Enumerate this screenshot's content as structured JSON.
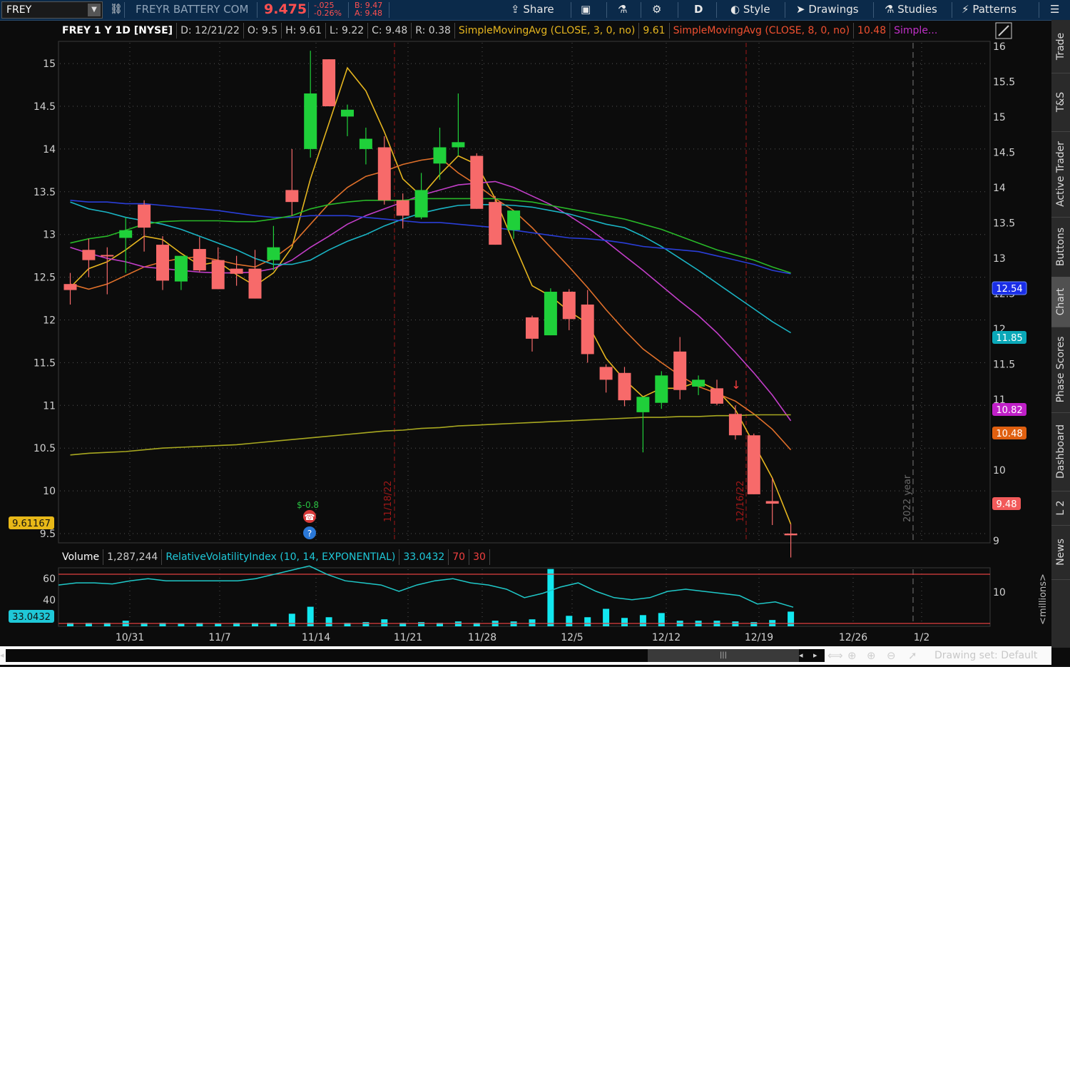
{
  "toolbar": {
    "symbol": "FREY",
    "company": "FREYR BATTERY COM",
    "last_price": "9.475",
    "net_change": "-.025",
    "pct_change": "-0.26%",
    "bid": "B: 9.47",
    "ask": "A: 9.48",
    "share_label": "Share",
    "aggregation": "D",
    "style_label": "Style",
    "drawings_label": "Drawings",
    "studies_label": "Studies",
    "patterns_label": "Patterns"
  },
  "side_tabs": [
    "Trade",
    "T&S",
    "Active Trader",
    "Buttons",
    "Chart",
    "Phase Scores",
    "Dashboard",
    "L 2",
    "News"
  ],
  "info_bar": {
    "title": "FREY 1 Y 1D [NYSE]",
    "date": "D: 12/21/22",
    "open": "O: 9.5",
    "high": "H: 9.61",
    "low": "L: 9.22",
    "close": "C: 9.48",
    "range": "R: 0.38",
    "sma3_label": "SimpleMovingAvg (CLOSE, 3, 0, no)",
    "sma3_value": "9.61",
    "sma8_label": "SimpleMovingAvg (CLOSE, 8, 0, no)",
    "sma8_value": "10.48",
    "sma_more": "Simple..."
  },
  "lower_info": {
    "volume_label": "Volume",
    "volume_value": "1,287,244",
    "rvi_label": "RelativeVolatilityIndex (10, 14, EXPONENTIAL)",
    "rvi_value": "33.0432",
    "level_70": "70",
    "level_30": "30"
  },
  "price_badges": {
    "blue": "12.54",
    "teal": "11.85",
    "magenta": "10.82",
    "orange": "10.48",
    "last": "9.48",
    "left_yellow": "9.61167",
    "left_rvi": "33.0432"
  },
  "chart_annotations": {
    "vline1": "11/18/22",
    "vline2": "12/16/22",
    "year_marker": "2022 year",
    "dividend_label": "$-0.8",
    "millions": "<millions>"
  },
  "bottom_bar": {
    "drawing_set": "Drawing set: Default"
  },
  "colors": {
    "up": "#1fd03a",
    "down": "#f76a6a",
    "sma3": "#e5b51f",
    "sma8": "#e0702a",
    "magenta": "#c23ec8",
    "teal": "#1ab4c4",
    "blue": "#2a3ed8",
    "green": "#28b828",
    "olive": "#a8a820",
    "rvi": "#1fc8c8"
  },
  "chart_data": {
    "type": "candlestick",
    "price_axis_right": [
      9,
      9.5,
      10,
      10.5,
      11,
      11.5,
      12,
      12.5,
      13,
      13.5,
      14,
      14.5,
      15,
      15.5,
      16
    ],
    "price_axis_left": [
      9.5,
      10,
      10.5,
      11,
      11.5,
      12,
      12.5,
      13,
      13.5,
      14,
      14.5,
      15
    ],
    "x_ticks": [
      "10/31",
      "11/7",
      "11/14",
      "11/21",
      "11/28",
      "12/5",
      "12/12",
      "12/19",
      "12/26",
      "1/2"
    ],
    "volume_axis": [
      10
    ],
    "rvi_axis": [
      40,
      60
    ],
    "candles": [
      {
        "o": 12.42,
        "h": 12.55,
        "l": 12.18,
        "c": 12.35
      },
      {
        "o": 12.82,
        "h": 12.95,
        "l": 12.5,
        "c": 12.7
      },
      {
        "o": 12.76,
        "h": 12.85,
        "l": 12.3,
        "c": 12.75
      },
      {
        "o": 12.96,
        "h": 13.2,
        "l": 12.55,
        "c": 13.05
      },
      {
        "o": 13.35,
        "h": 13.4,
        "l": 12.8,
        "c": 13.08
      },
      {
        "o": 12.88,
        "h": 12.98,
        "l": 12.35,
        "c": 12.46
      },
      {
        "o": 12.45,
        "h": 12.75,
        "l": 12.35,
        "c": 12.75
      },
      {
        "o": 12.83,
        "h": 12.97,
        "l": 12.56,
        "c": 12.58
      },
      {
        "o": 12.7,
        "h": 12.85,
        "l": 12.36,
        "c": 12.36
      },
      {
        "o": 12.6,
        "h": 12.75,
        "l": 12.4,
        "c": 12.54
      },
      {
        "o": 12.6,
        "h": 12.82,
        "l": 12.25,
        "c": 12.25
      },
      {
        "o": 12.7,
        "h": 13.1,
        "l": 12.58,
        "c": 12.85
      },
      {
        "o": 13.52,
        "h": 14.0,
        "l": 13.22,
        "c": 13.38
      },
      {
        "o": 14.0,
        "h": 15.15,
        "l": 13.9,
        "c": 14.65
      },
      {
        "o": 15.05,
        "h": 15.05,
        "l": 14.5,
        "c": 14.5
      },
      {
        "o": 14.38,
        "h": 14.52,
        "l": 14.15,
        "c": 14.46
      },
      {
        "o": 14.0,
        "h": 14.25,
        "l": 13.82,
        "c": 14.12
      },
      {
        "o": 14.02,
        "h": 14.15,
        "l": 13.35,
        "c": 13.4
      },
      {
        "o": 13.4,
        "h": 13.48,
        "l": 13.07,
        "c": 13.22
      },
      {
        "o": 13.2,
        "h": 13.72,
        "l": 13.18,
        "c": 13.52
      },
      {
        "o": 13.83,
        "h": 14.25,
        "l": 13.64,
        "c": 14.02
      },
      {
        "o": 14.02,
        "h": 14.65,
        "l": 13.92,
        "c": 14.08
      },
      {
        "o": 13.92,
        "h": 13.95,
        "l": 13.3,
        "c": 13.3
      },
      {
        "o": 13.38,
        "h": 13.45,
        "l": 12.88,
        "c": 12.88
      },
      {
        "o": 13.05,
        "h": 13.28,
        "l": 12.95,
        "c": 13.28
      },
      {
        "o": 12.03,
        "h": 12.05,
        "l": 11.63,
        "c": 11.78
      },
      {
        "o": 11.82,
        "h": 12.37,
        "l": 11.82,
        "c": 12.33
      },
      {
        "o": 12.33,
        "h": 12.36,
        "l": 11.88,
        "c": 12.01
      },
      {
        "o": 12.18,
        "h": 12.35,
        "l": 11.5,
        "c": 11.6
      },
      {
        "o": 11.45,
        "h": 11.48,
        "l": 11.15,
        "c": 11.3
      },
      {
        "o": 11.38,
        "h": 11.45,
        "l": 10.99,
        "c": 11.06
      },
      {
        "o": 10.92,
        "h": 11.05,
        "l": 10.45,
        "c": 11.1
      },
      {
        "o": 11.03,
        "h": 11.4,
        "l": 10.96,
        "c": 11.35
      },
      {
        "o": 11.63,
        "h": 11.8,
        "l": 11.07,
        "c": 11.18
      },
      {
        "o": 11.22,
        "h": 11.35,
        "l": 11.12,
        "c": 11.3
      },
      {
        "o": 11.2,
        "h": 11.3,
        "l": 11.0,
        "c": 11.02
      },
      {
        "o": 10.9,
        "h": 11.0,
        "l": 10.6,
        "c": 10.65
      },
      {
        "o": 10.65,
        "h": 10.67,
        "l": 9.96,
        "c": 9.96
      },
      {
        "o": 9.88,
        "h": 10.15,
        "l": 9.6,
        "c": 9.85
      },
      {
        "o": 9.5,
        "h": 9.61,
        "l": 9.22,
        "c": 9.48
      }
    ],
    "series": [
      {
        "name": "SimpleMovingAvg (CLOSE, 3, 0, no)",
        "color": "#e5b51f",
        "values": [
          12.38,
          12.6,
          12.68,
          12.82,
          12.98,
          12.94,
          12.78,
          12.64,
          12.68,
          12.53,
          12.4,
          12.55,
          12.85,
          13.65,
          14.3,
          14.95,
          14.68,
          14.2,
          13.65,
          13.45,
          13.7,
          13.92,
          13.82,
          13.42,
          12.9,
          12.4,
          12.28,
          12.1,
          11.96,
          11.55,
          11.3,
          11.1,
          11.2,
          11.2,
          11.28,
          11.18,
          10.95,
          10.55,
          10.15,
          9.61
        ]
      },
      {
        "name": "SimpleMovingAvg (CLOSE, 8, 0, no)",
        "color": "#e0702a",
        "values": [
          12.42,
          12.36,
          12.42,
          12.52,
          12.62,
          12.68,
          12.72,
          12.74,
          12.7,
          12.65,
          12.62,
          12.72,
          12.88,
          13.12,
          13.36,
          13.55,
          13.68,
          13.74,
          13.82,
          13.87,
          13.9,
          13.72,
          13.58,
          13.42,
          13.28,
          13.08,
          12.85,
          12.62,
          12.38,
          12.12,
          11.88,
          11.66,
          11.5,
          11.35,
          11.22,
          11.14,
          11.05,
          10.9,
          10.72,
          10.48
        ]
      },
      {
        "name": "magenta MA",
        "color": "#c23ec8",
        "values": [
          12.85,
          12.78,
          12.72,
          12.68,
          12.62,
          12.6,
          12.58,
          12.56,
          12.55,
          12.55,
          12.56,
          12.6,
          12.7,
          12.85,
          12.98,
          13.12,
          13.22,
          13.3,
          13.38,
          13.46,
          13.52,
          13.58,
          13.6,
          13.62,
          13.55,
          13.45,
          13.35,
          13.22,
          13.08,
          12.92,
          12.75,
          12.58,
          12.4,
          12.22,
          12.05,
          11.85,
          11.62,
          11.38,
          11.12,
          10.82
        ]
      },
      {
        "name": "teal MA",
        "color": "#1ab4c4",
        "values": [
          13.38,
          13.3,
          13.26,
          13.2,
          13.16,
          13.12,
          13.06,
          12.98,
          12.9,
          12.82,
          12.72,
          12.65,
          12.65,
          12.7,
          12.82,
          12.92,
          13.0,
          13.1,
          13.18,
          13.25,
          13.3,
          13.34,
          13.35,
          13.35,
          13.34,
          13.32,
          13.28,
          13.24,
          13.18,
          13.12,
          13.08,
          12.98,
          12.86,
          12.72,
          12.58,
          12.43,
          12.28,
          12.13,
          11.98,
          11.85
        ]
      },
      {
        "name": "blue MA",
        "color": "#2a3ed8",
        "values": [
          13.4,
          13.38,
          13.38,
          13.36,
          13.36,
          13.34,
          13.32,
          13.3,
          13.28,
          13.25,
          13.22,
          13.2,
          13.2,
          13.22,
          13.22,
          13.22,
          13.2,
          13.18,
          13.16,
          13.14,
          13.14,
          13.12,
          13.1,
          13.08,
          13.05,
          13.02,
          12.99,
          12.96,
          12.95,
          12.93,
          12.9,
          12.86,
          12.84,
          12.82,
          12.8,
          12.75,
          12.7,
          12.65,
          12.58,
          12.54
        ]
      },
      {
        "name": "green MA",
        "color": "#28b828",
        "values": [
          12.9,
          12.95,
          12.98,
          13.05,
          13.12,
          13.15,
          13.16,
          13.16,
          13.16,
          13.15,
          13.15,
          13.18,
          13.22,
          13.3,
          13.35,
          13.38,
          13.4,
          13.4,
          13.4,
          13.42,
          13.42,
          13.42,
          13.42,
          13.42,
          13.4,
          13.38,
          13.34,
          13.3,
          13.26,
          13.22,
          13.18,
          13.12,
          13.06,
          12.98,
          12.9,
          12.82,
          12.76,
          12.7,
          12.62,
          12.55
        ]
      },
      {
        "name": "olive MA",
        "color": "#a8a820",
        "values": [
          10.42,
          10.44,
          10.45,
          10.46,
          10.48,
          10.5,
          10.51,
          10.52,
          10.53,
          10.54,
          10.56,
          10.58,
          10.6,
          10.62,
          10.64,
          10.66,
          10.68,
          10.7,
          10.71,
          10.73,
          10.74,
          10.76,
          10.77,
          10.78,
          10.79,
          10.8,
          10.81,
          10.82,
          10.83,
          10.84,
          10.85,
          10.86,
          10.86,
          10.87,
          10.87,
          10.88,
          10.88,
          10.89,
          10.89,
          10.89
        ]
      }
    ],
    "volume_millions": [
      0.5,
      0.5,
      0.5,
      0.8,
      0.5,
      0.5,
      0.4,
      0.5,
      0.4,
      0.5,
      0.5,
      0.5,
      1.8,
      2.8,
      1.3,
      0.5,
      0.6,
      1.0,
      0.5,
      0.6,
      0.5,
      0.7,
      0.5,
      0.8,
      0.7,
      1.0,
      8.2,
      1.5,
      1.3,
      2.5,
      1.2,
      1.6,
      1.9,
      0.8,
      0.8,
      0.8,
      0.7,
      0.6,
      0.9,
      2.1
    ],
    "rvi": [
      54,
      56,
      56,
      55,
      58,
      60,
      58,
      58,
      58,
      58,
      58,
      60,
      64,
      68,
      72,
      64,
      58,
      56,
      54,
      48,
      54,
      58,
      60,
      56,
      54,
      50,
      42,
      46,
      52,
      56,
      48,
      42,
      40,
      42,
      48,
      50,
      48,
      46,
      44,
      36,
      38,
      33
    ],
    "rvi_levels": [
      70,
      30
    ]
  }
}
